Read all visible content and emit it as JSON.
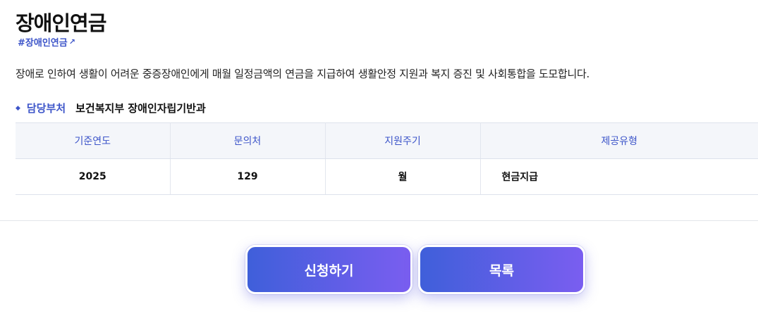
{
  "page": {
    "title": "장애인연금",
    "tag": "#장애인연금",
    "description": "장애로 인하여 생활이 어려운 중증장애인에게 매월 일정금액의 연금을 지급하여 생활안정 지원과 복지 증진 및 사회통합을 도모합니다."
  },
  "department": {
    "label": "담당부처",
    "value": "보건복지부 장애인자립기반과"
  },
  "table": {
    "headers": [
      "기준연도",
      "문의처",
      "지원주기",
      "제공유형"
    ],
    "row": [
      "2025",
      "129",
      "월",
      "현금지급"
    ]
  },
  "buttons": {
    "apply_label": "신청하기",
    "list_label": "목록"
  },
  "icons": {
    "external_link": "↗",
    "bullet": "◆"
  },
  "colors": {
    "accent": "#3d55c9",
    "button_gradient_start": "#3f5fda",
    "button_gradient_end": "#7a5ef0",
    "table_header_bg": "#f4f6fa"
  }
}
